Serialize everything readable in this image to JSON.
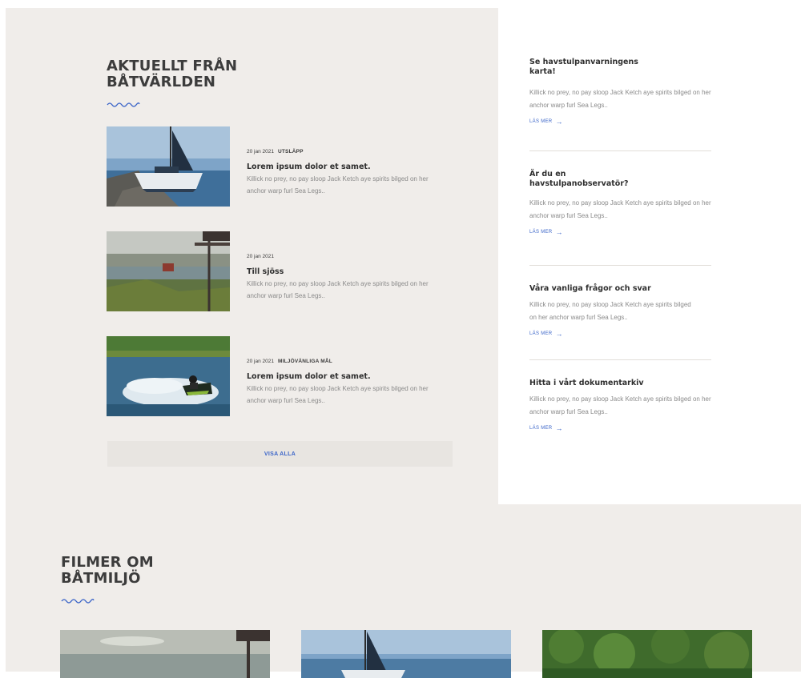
{
  "news": {
    "title": "AKTUELLT FRÅN BÅTVÄRLDEN",
    "items": [
      {
        "date": "20 jan 2021",
        "tag": "UTSLÄPP",
        "title": "Lorem ipsum dolor et samet.",
        "excerpt": "Killick no prey, no pay sloop Jack Ketch aye spirits bilged on her anchor warp furl Sea Legs.."
      },
      {
        "date": "20 jan 2021",
        "tag": "",
        "title": "Till sjöss",
        "excerpt": "Killick no prey, no pay sloop Jack Ketch aye spirits bilged on her anchor warp furl Sea Legs.."
      },
      {
        "date": "20 jan 2021",
        "tag": "MILJÖVÄNLIGA MÅL",
        "title": "Lorem ipsum dolor et samet.",
        "excerpt": "Killick no prey, no pay sloop Jack Ketch aye spirits bilged on her anchor warp furl Sea Legs.."
      }
    ],
    "view_all": "VISA ALLA"
  },
  "sidebar": {
    "items": [
      {
        "title": "Se havstulpanvarningens karta!",
        "text": "Killick no prey, no pay sloop Jack Ketch aye spirits bilged on her anchor warp furl Sea Legs..",
        "link": "LÄS MER"
      },
      {
        "title": "Är du en havstulpanobservatör?",
        "text": "Killick no prey, no pay sloop Jack Ketch aye spirits bilged on her anchor warp furl Sea Legs..",
        "link": "LÄS MER"
      },
      {
        "title": "Våra vanliga frågor och svar",
        "text": "Killick no prey, no pay sloop Jack Ketch aye spirits bilged on her anchor warp furl Sea Legs..",
        "link": "LÄS MER"
      },
      {
        "title": "Hitta i vårt dokumentarkiv",
        "text": "Killick no prey, no pay sloop Jack Ketch aye spirits bilged on her anchor warp furl Sea Legs..",
        "link": "LÄS MER"
      }
    ]
  },
  "films": {
    "title": "FILMER OM BÅTMILJÖ"
  },
  "colors": {
    "panel_bg": "#f0edea",
    "accent": "#3a64c8",
    "heading": "#3c3c3c",
    "muted_text": "#8a8a8a"
  },
  "icons": {
    "wave": "wave-divider-icon",
    "arrow": "arrow-right-icon"
  }
}
